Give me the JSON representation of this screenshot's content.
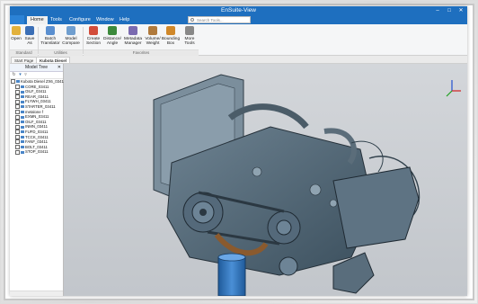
{
  "app": {
    "title": "EnSuite-View"
  },
  "window_controls": [
    "–",
    "□",
    "✕"
  ],
  "menu": {
    "items": [
      {
        "label": "Home",
        "active": true
      },
      {
        "label": "Tools",
        "active": false
      },
      {
        "label": "Configure",
        "active": false
      },
      {
        "label": "Window",
        "active": false
      },
      {
        "label": "Help",
        "active": false
      }
    ],
    "search_placeholder": "Search Tools..."
  },
  "ribbon": {
    "buttons": [
      {
        "label": "Open",
        "icon": "folder-icon",
        "color": "#e2b13c"
      },
      {
        "label": "Save As",
        "icon": "save-icon",
        "color": "#3b6fb6"
      },
      {
        "label": "Batch Translator",
        "icon": "batch-icon",
        "color": "#5a8fd0"
      },
      {
        "label": "Model Compare",
        "icon": "compare-icon",
        "color": "#6f9ecf"
      },
      {
        "label": "Create Section",
        "icon": "section-icon",
        "color": "#d24c3a"
      },
      {
        "label": "Distance/ Angle",
        "icon": "measure-icon",
        "color": "#3c8a3c"
      },
      {
        "label": "Metadata Manager",
        "icon": "metadata-icon",
        "color": "#7a6ab0"
      },
      {
        "label": "Volume/ Weight",
        "icon": "volume-icon",
        "color": "#b07a3c"
      },
      {
        "label": "Bounding Box",
        "icon": "bbox-icon",
        "color": "#d0882a"
      },
      {
        "label": "More Tools",
        "icon": "more-tools-icon",
        "color": "#888888"
      }
    ],
    "groups": [
      "Standard",
      "Utilities",
      "Favorites"
    ]
  },
  "doc_tabs": [
    {
      "label": "Start Page",
      "active": false
    },
    {
      "label": "Kubota Diesel",
      "active": true
    }
  ],
  "model_tree": {
    "title": "Model Tree",
    "root": "Kubota Diesel ZX6_03411",
    "items": [
      "CORE_03411",
      "OILF_03411",
      "REAR_03411",
      "FLYWH_03411",
      "STARTER_03411",
      "metalone f",
      "EXMN_03411",
      "OILF_03411",
      "INMN_03411",
      "FUFD_03411",
      "TCCK_03411",
      "FANF_03411",
      "BOLT_03411",
      "STOP_03411"
    ]
  },
  "colors": {
    "accent": "#1e6fbf",
    "viewport_bg": "#c9cdd2",
    "model_body": "#4c6272",
    "filter_blue": "#2f6fb3"
  }
}
